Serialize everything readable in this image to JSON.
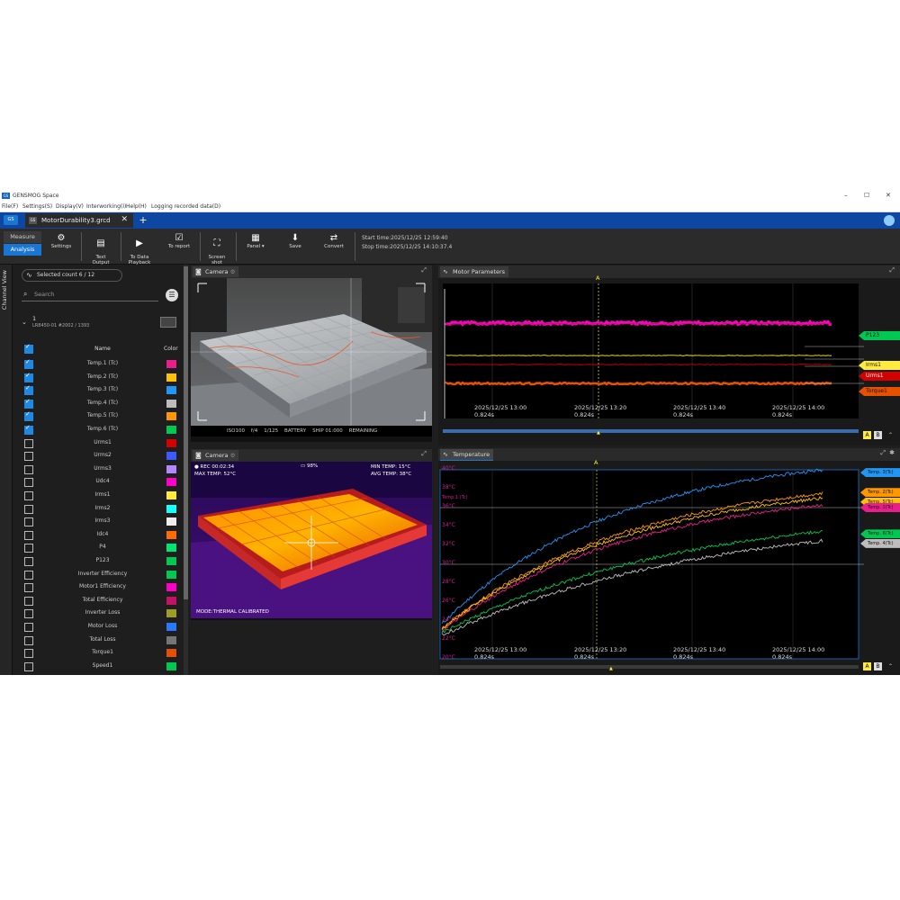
{
  "window": {
    "logo": "GS",
    "title": "GENSMOG Space",
    "minimize": "–",
    "maximize": "☐",
    "close": "✕"
  },
  "menu": [
    "File(F)",
    "Settings(S)",
    "Display(V)",
    "Interworking(I)",
    "Help(H)",
    "Logging recorded data(D)"
  ],
  "tabs": {
    "home_icon": "GS",
    "doc_icon": "GS",
    "doc_title": "MotorDurability3.grcd",
    "close": "✕",
    "add": "+"
  },
  "toolbar": {
    "mode_measure": "Measure",
    "mode_analysis": "Analysis",
    "settings": "Settings",
    "text_output": "Text\nOutput",
    "to_data_playback": "To Data\nPlayback",
    "to_report": "To report",
    "screenshot": "Screen\nshot",
    "panel": "Panel ▾",
    "save": "Save",
    "convert": "Convert",
    "start_time": "Start time:2025/12/25 12:59:40",
    "stop_time": "Stop time:2025/12/25 14:10:37.4"
  },
  "sidebar": {
    "channel_view": "Channel View",
    "selected_count": "Selected count 6 / 12",
    "search_placeholder": "Search",
    "device_number": "1",
    "device_name": "LR8450-01 #2002 / 1393",
    "col_name": "Name",
    "col_color": "Color",
    "channels": [
      {
        "name": "Temp.1 (Tc)",
        "color": "#e91e8c",
        "checked": true
      },
      {
        "name": "Temp.2 (Tc)",
        "color": "#ffc107",
        "checked": true
      },
      {
        "name": "Temp.3 (Tc)",
        "color": "#2196f3",
        "checked": true
      },
      {
        "name": "Temp.4 (Tc)",
        "color": "#bdbdbd",
        "checked": true
      },
      {
        "name": "Temp.5 (Tc)",
        "color": "#ff9800",
        "checked": true
      },
      {
        "name": "Temp.6 (Tc)",
        "color": "#00c853",
        "checked": true
      },
      {
        "name": "Urms1",
        "color": "#d50000",
        "checked": false
      },
      {
        "name": "Urms2",
        "color": "#3d5afe",
        "checked": false
      },
      {
        "name": "Urms3",
        "color": "#b388ff",
        "checked": false
      },
      {
        "name": "Udc4",
        "color": "#ff00c8",
        "checked": false
      },
      {
        "name": "Irms1",
        "color": "#ffeb3b",
        "checked": false
      },
      {
        "name": "Irms2",
        "color": "#18ffff",
        "checked": false
      },
      {
        "name": "Irms3",
        "color": "#eeeeee",
        "checked": false
      },
      {
        "name": "Idc4",
        "color": "#ff6d00",
        "checked": false
      },
      {
        "name": "P4",
        "color": "#00e676",
        "checked": false
      },
      {
        "name": "P123",
        "color": "#00c853",
        "checked": false
      },
      {
        "name": "Inverter Efficiency",
        "color": "#00c853",
        "checked": false
      },
      {
        "name": "Motor1 Efficiency",
        "color": "#ff00c8",
        "checked": false
      },
      {
        "name": "Total Efficiency",
        "color": "#c51162",
        "checked": false
      },
      {
        "name": "Inverter Loss",
        "color": "#9e9d24",
        "checked": false
      },
      {
        "name": "Motor Loss",
        "color": "#2979ff",
        "checked": false
      },
      {
        "name": "Total Loss",
        "color": "#757575",
        "checked": false
      },
      {
        "name": "Torque1",
        "color": "#e65100",
        "checked": false
      },
      {
        "name": "Speed1",
        "color": "#00c853",
        "checked": false
      }
    ]
  },
  "camera_top": {
    "title": "Camera",
    "overlay": "ISO100    f/4    1/125    BATTERY    SHIP 01:000    REMAINING"
  },
  "camera_bottom": {
    "title": "Camera",
    "rec": "● REC 00:02:34",
    "max_temp": "MAX TEMP: 52°C",
    "battery": "98%",
    "min_temp": "MIN TEMP: 15°C",
    "avg_temp": "AVG TEMP: 38°C",
    "mode": "MODE:THERMAL CALIBRATED"
  },
  "motor_chart": {
    "title": "Motor Parameters",
    "cursor": "A",
    "x_ticks": [
      {
        "t": "2025/12/25 13:00",
        "s": "0.824s"
      },
      {
        "t": "2025/12/25 13:20",
        "s": "0.824s"
      },
      {
        "t": "2025/12/25 13:40",
        "s": "0.824s"
      },
      {
        "t": "2025/12/25 14:00",
        "s": "0.824s"
      }
    ],
    "tags": [
      {
        "name": "P123",
        "color": "#00c853"
      },
      {
        "name": "Irms1",
        "color": "#ffeb3b"
      },
      {
        "name": "Urms1",
        "color": "#d50000"
      },
      {
        "name": "Torque1",
        "color": "#e65100"
      }
    ],
    "ab": [
      "A",
      "B"
    ]
  },
  "temp_chart": {
    "title": "Temperature",
    "cursor": "A",
    "y_label": "Temp.1 (Tc)",
    "y_ticks": [
      "40°C",
      "38°C",
      "36°C",
      "34°C",
      "32°C",
      "30°C",
      "28°C",
      "26°C",
      "24°C",
      "22°C",
      "20°C"
    ],
    "x_ticks": [
      {
        "t": "2025/12/25 13:00",
        "s": "0.824s"
      },
      {
        "t": "2025/12/25 13:20",
        "s": "0.824s"
      },
      {
        "t": "2025/12/25 13:40",
        "s": "0.824s"
      },
      {
        "t": "2025/12/25 14:00",
        "s": "0.824s"
      }
    ],
    "tags": [
      {
        "name": "Temp. 3(Tc)",
        "color": "#2196f3"
      },
      {
        "name": "Temp. 2(Tc)",
        "color": "#ff9800"
      },
      {
        "name": "Temp. 5(Tc)",
        "color": "#ffc107"
      },
      {
        "name": "Temp. 1(Tc)",
        "color": "#e91e8c"
      },
      {
        "name": "Temp. 6(Tc)",
        "color": "#00c853"
      },
      {
        "name": "Temp. 4(Tc)",
        "color": "#bdbdbd"
      }
    ],
    "ab": [
      "A",
      "B"
    ]
  }
}
